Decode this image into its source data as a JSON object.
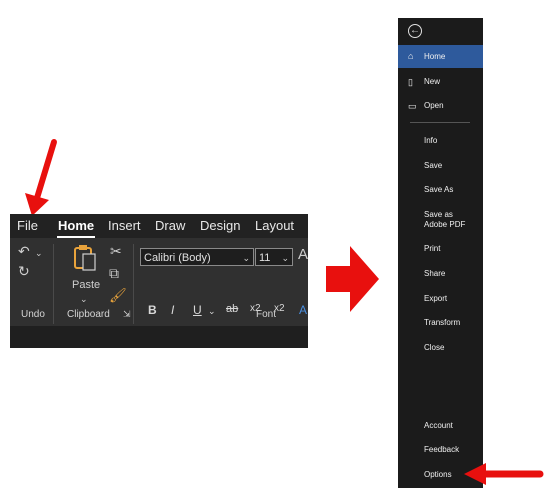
{
  "ribbon": {
    "tabs": [
      "File",
      "Home",
      "Insert",
      "Draw",
      "Design",
      "Layout"
    ],
    "font_name": "Calibri (Body)",
    "font_size": "11",
    "paste_label": "Paste",
    "group_labels": [
      "Undo",
      "Clipboard",
      "Font"
    ],
    "format_buttons": [
      "B",
      "I",
      "U",
      "ab",
      "x2",
      "x2"
    ],
    "font_glyph": "A",
    "icons": [
      "undo-icon",
      "redo-icon",
      "paste-icon",
      "cut-icon",
      "copy-icon",
      "format-painter-icon"
    ]
  },
  "backstage": {
    "back_icon": "←",
    "top_items": [
      {
        "label": "Home",
        "icon": "home-icon",
        "glyph": "⌂",
        "selected": true
      },
      {
        "label": "New",
        "icon": "new-doc-icon",
        "glyph": "▯",
        "selected": false
      },
      {
        "label": "Open",
        "icon": "folder-icon",
        "glyph": "▭",
        "selected": false
      }
    ],
    "mid_items": [
      "Info",
      "Save",
      "Save As",
      "Save as Adobe PDF",
      "Print",
      "Share",
      "Export",
      "Transform",
      "Close"
    ],
    "bottom_items": [
      "Account",
      "Feedback",
      "Options"
    ]
  },
  "colors": {
    "arrow": "#e8100e",
    "selected": "#2e5a9c",
    "panel": "#1b1b1b"
  }
}
